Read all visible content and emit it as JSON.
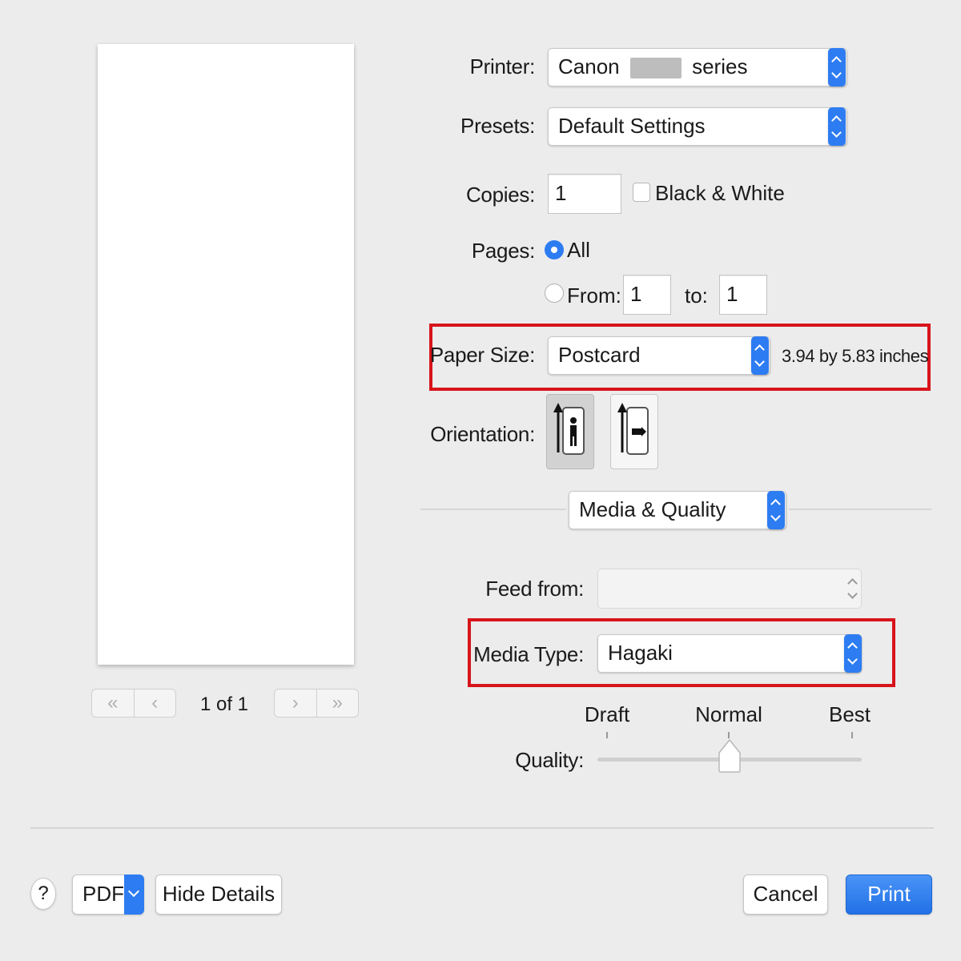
{
  "printer": {
    "label": "Printer:",
    "value_prefix": "Canon",
    "value_suffix": "series"
  },
  "presets": {
    "label": "Presets:",
    "value": "Default Settings"
  },
  "copies": {
    "label": "Copies:",
    "value": "1",
    "bw_label": "Black & White",
    "bw_checked": false
  },
  "pages": {
    "label": "Pages:",
    "all_label": "All",
    "from_label": "From:",
    "from_value": "1",
    "to_label": "to:",
    "to_value": "1",
    "selected": "All"
  },
  "paper_size": {
    "label": "Paper Size:",
    "value": "Postcard",
    "dimensions": "3.94 by 5.83 inches"
  },
  "orientation": {
    "label": "Orientation:",
    "options": [
      "portrait",
      "landscape"
    ],
    "selected": "portrait"
  },
  "section": {
    "value": "Media & Quality"
  },
  "feed_from": {
    "label": "Feed from:",
    "value": ""
  },
  "media_type": {
    "label": "Media Type:",
    "value": "Hagaki"
  },
  "quality": {
    "label": "Quality:",
    "ticks": [
      "Draft",
      "Normal",
      "Best"
    ],
    "selected": "Normal"
  },
  "preview": {
    "page_indicator": "1 of 1"
  },
  "footer": {
    "help_label": "?",
    "pdf_label": "PDF",
    "hide_details_label": "Hide Details",
    "cancel_label": "Cancel",
    "print_label": "Print"
  },
  "colors": {
    "accent": "#2d7cf2",
    "highlight_box": "#d7141a"
  }
}
